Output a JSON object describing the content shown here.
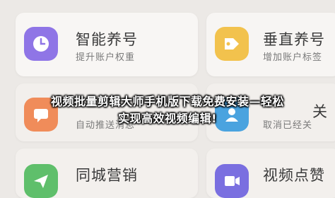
{
  "cards": [
    {
      "title": "智能养号",
      "subtitle": "提升账户权重",
      "icon": "clock-icon",
      "color": "#8f75e6"
    },
    {
      "title": "垂直养号",
      "subtitle": "增加账户标签",
      "icon": "tag-icon",
      "color": "#f2c24d"
    },
    {
      "title": "",
      "subtitle": "自动推送消息",
      "icon": "message-icon",
      "color": "#f08c5a"
    },
    {
      "title": "关",
      "subtitle": "取消已经关",
      "icon": "user-icon",
      "color": "#4aa3df"
    },
    {
      "title": "同城营销",
      "subtitle": "",
      "icon": "send-icon",
      "color": "#5fbf6b"
    },
    {
      "title": "视频点赞",
      "subtitle": "",
      "icon": "video-icon",
      "color": "#7a6fe0"
    }
  ],
  "overlay": {
    "line1": "视频批量剪辑大师手机版下载免费安装—轻松",
    "line2": "实现高效视频编辑!"
  }
}
